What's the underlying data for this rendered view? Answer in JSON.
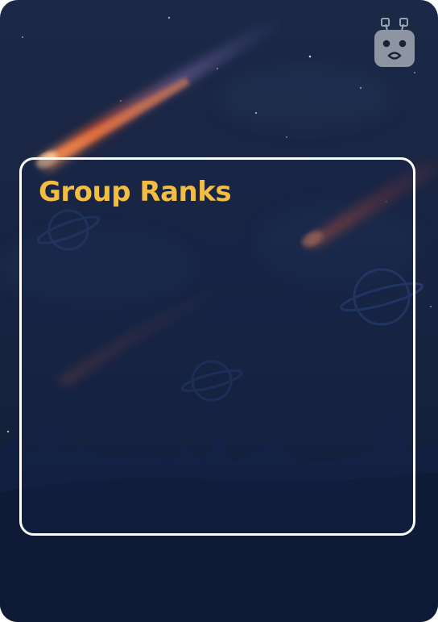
{
  "panel": {
    "title": "Group Ranks"
  },
  "icons": {
    "mascot": "robot-face-icon"
  },
  "colors": {
    "title": "#f3bd42",
    "panel_border": "#ffffff",
    "sky_top": "#1b2846",
    "sky_bottom": "#0b1220"
  }
}
